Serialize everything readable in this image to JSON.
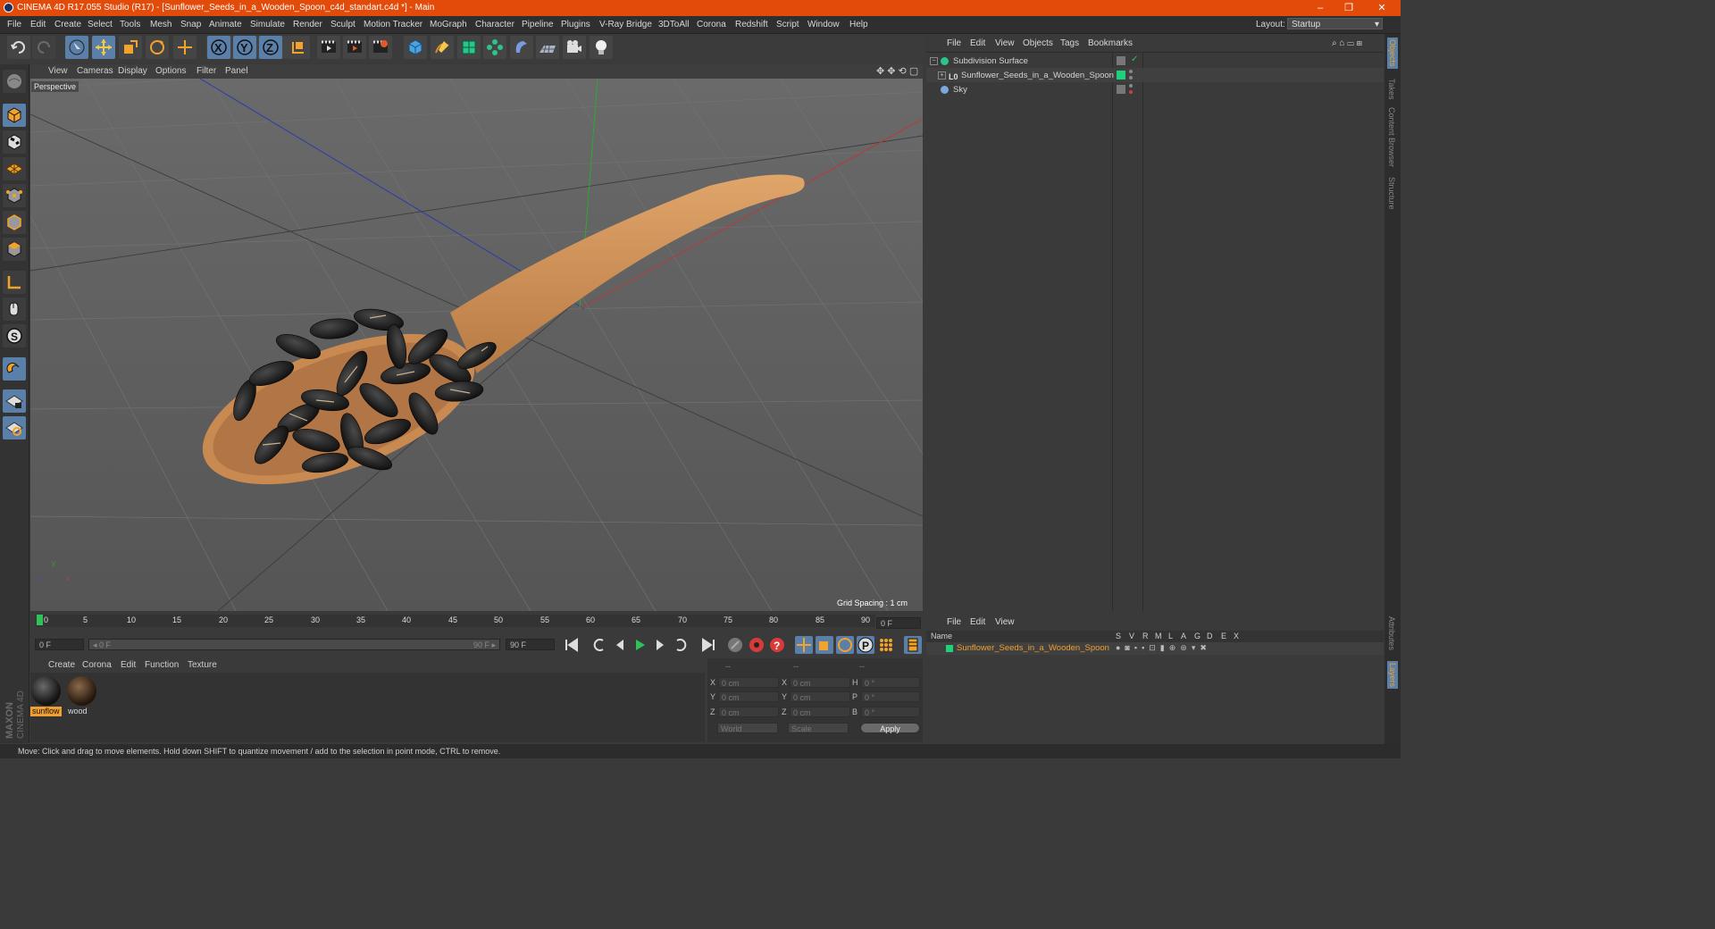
{
  "window": {
    "title": "CINEMA 4D R17.055 Studio (R17) - [Sunflower_Seeds_in_a_Wooden_Spoon_c4d_standart.c4d *] - Main",
    "controls": [
      "–",
      "❐",
      "✕"
    ]
  },
  "menubar": {
    "items": [
      "File",
      "Edit",
      "Create",
      "Select",
      "Tools",
      "Mesh",
      "Snap",
      "Animate",
      "Simulate",
      "Render",
      "Sculpt",
      "Motion Tracker",
      "MoGraph",
      "Character",
      "Pipeline",
      "Plugins",
      "V-Ray Bridge",
      "3DToAll",
      "Corona",
      "Redshift",
      "Script",
      "Window",
      "Help"
    ],
    "layout_label": "Layout:",
    "layout_value": "Startup"
  },
  "toolbar": {
    "icons": [
      "undo-icon",
      "redo-icon",
      "select-arrow-icon",
      "move-icon",
      "scale-icon",
      "rotate-icon",
      "move-alt-icon",
      "x-axis-icon",
      "y-axis-icon",
      "z-axis-icon",
      "coordinate-system-icon",
      "render-view-icon",
      "render-picture-viewer-icon",
      "render-settings-icon",
      "cube-icon",
      "pen-spline-icon",
      "subdivision-icon",
      "array-icon",
      "deformer-icon",
      "floor-icon",
      "camera-icon",
      "light-icon"
    ],
    "axis_labels": [
      "X",
      "Y",
      "Z"
    ]
  },
  "viewport": {
    "menu": [
      "View",
      "Cameras",
      "Display",
      "Options",
      "Filter",
      "Panel"
    ],
    "camera_label": "Perspective",
    "grid_spacing": "Grid Spacing : 1 cm",
    "axis_labels": [
      "y",
      "x",
      "z"
    ]
  },
  "timeline": {
    "ticks": [
      "0",
      "5",
      "10",
      "15",
      "20",
      "25",
      "30",
      "35",
      "40",
      "45",
      "50",
      "55",
      "60",
      "65",
      "70",
      "75",
      "80",
      "85",
      "90"
    ],
    "current_frame": "0 F",
    "start_field": "0 F",
    "range_start": "◂ 0 F",
    "range_end": "90 F ▸",
    "end_field": "90 F"
  },
  "materials": {
    "menu": [
      "Create",
      "Corona",
      "Edit",
      "Function",
      "Texture"
    ],
    "items": [
      {
        "name": "sunflow",
        "selected": true
      },
      {
        "name": "wood",
        "selected": false
      }
    ]
  },
  "coordinates": {
    "headers": [
      "--",
      "--",
      "--"
    ],
    "rows": [
      {
        "a": "X",
        "av": "0 cm",
        "b": "X",
        "bv": "0 cm",
        "c": "H",
        "cv": "0 °"
      },
      {
        "a": "Y",
        "av": "0 cm",
        "b": "Y",
        "bv": "0 cm",
        "c": "P",
        "cv": "0 °"
      },
      {
        "a": "Z",
        "av": "0 cm",
        "b": "Z",
        "bv": "0 cm",
        "c": "B",
        "cv": "0 °"
      }
    ],
    "mode1": "World",
    "mode2": "Scale",
    "apply": "Apply"
  },
  "status_bar": "Move: Click and drag to move elements. Hold down SHIFT to quantize movement / add to the selection in point mode, CTRL to remove.",
  "object_manager": {
    "menu": [
      "File",
      "Edit",
      "View",
      "Objects",
      "Tags",
      "Bookmarks"
    ],
    "objects": [
      {
        "name": "Subdivision Surface",
        "icon": "subdivision-icon"
      },
      {
        "name": "Sunflower_Seeds_in_a_Wooden_Spoon",
        "icon": "null-object-icon"
      },
      {
        "name": "Sky",
        "icon": "sky-icon"
      }
    ]
  },
  "layer_manager": {
    "menu": [
      "File",
      "Edit",
      "View"
    ],
    "headers": [
      "Name",
      "S",
      "V",
      "R",
      "M",
      "L",
      "A",
      "G",
      "D",
      "E",
      "X"
    ],
    "layers": [
      {
        "name": "Sunflower_Seeds_in_a_Wooden_Spoon",
        "color": "#1ed27a"
      }
    ]
  },
  "side_tabs": [
    "Objects",
    "Takes",
    "Content Browser",
    "Structure",
    "Attributes",
    "Layers"
  ],
  "colors": {
    "accent_orange": "#e34b0b",
    "highlight_blue": "#5a7fa8",
    "layer_green": "#1ed27a",
    "selected_text": "#f0a030"
  }
}
